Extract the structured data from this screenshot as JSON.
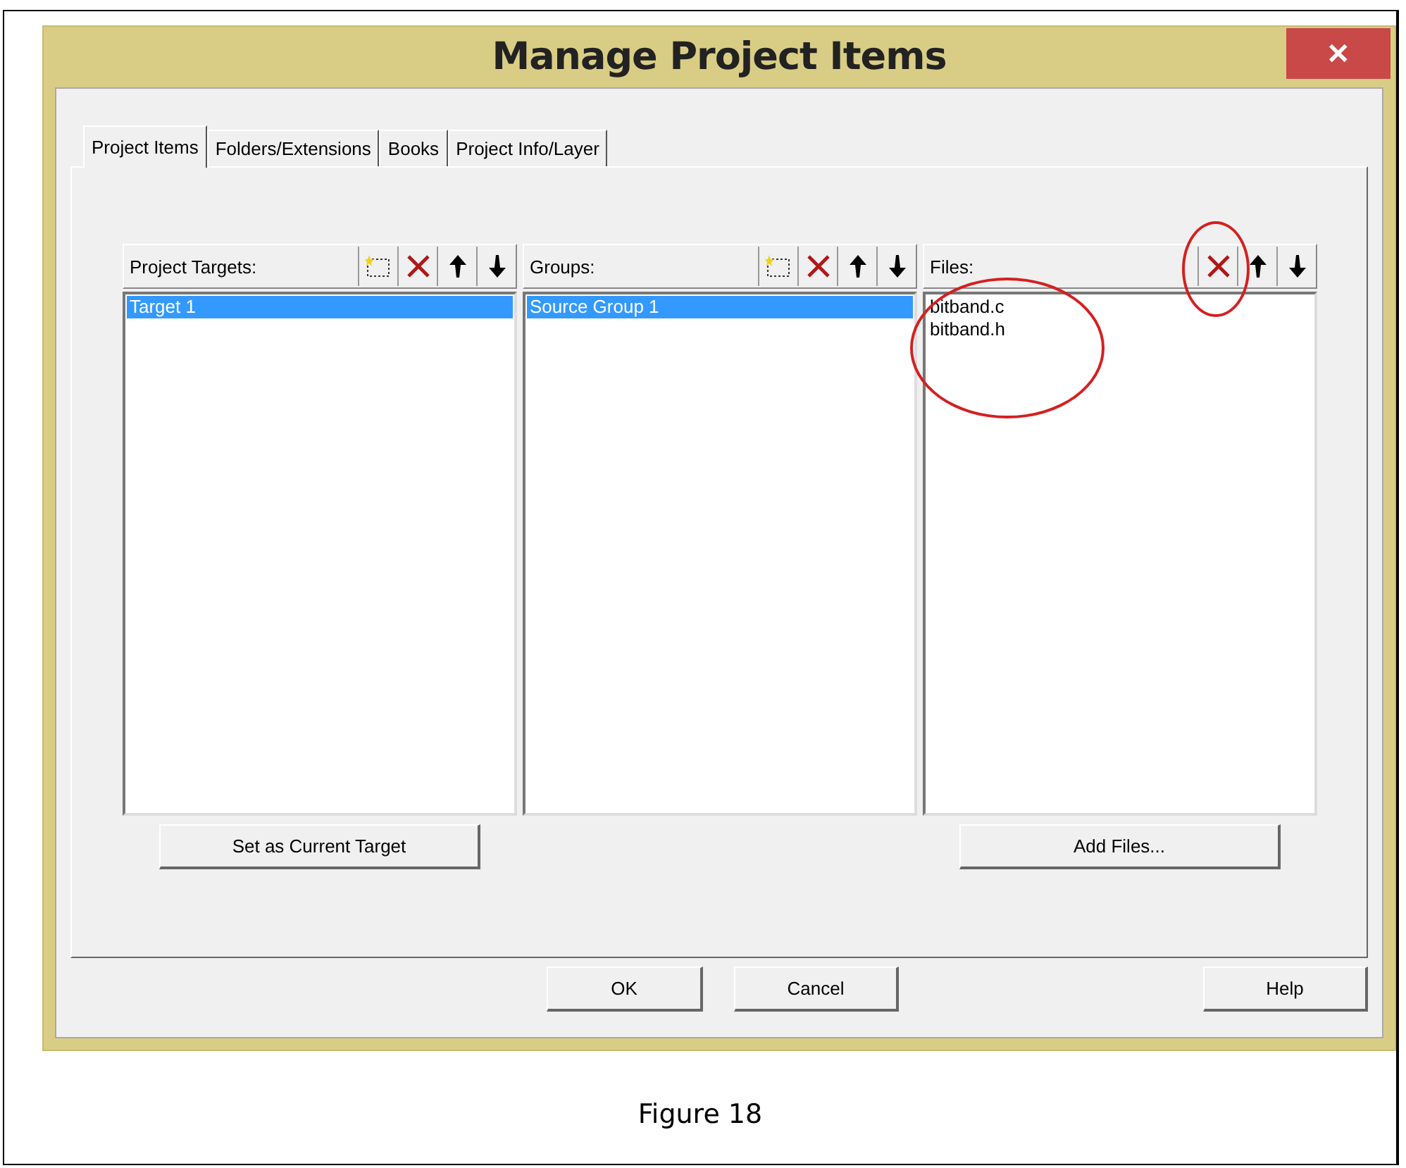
{
  "window": {
    "title": "Manage Project Items",
    "close": "✕"
  },
  "tabs": [
    {
      "label": "Project Items",
      "selected": true
    },
    {
      "label": "Folders/Extensions",
      "selected": false
    },
    {
      "label": "Books",
      "selected": false
    },
    {
      "label": "Project Info/Layer",
      "selected": false
    }
  ],
  "panels": [
    {
      "label": "Project Targets:",
      "tools": [
        {
          "kind": "new",
          "circled": false
        },
        {
          "kind": "delete",
          "circled": false
        },
        {
          "kind": "up",
          "circled": false
        },
        {
          "kind": "down",
          "circled": false
        }
      ],
      "items": [
        {
          "label": "Target 1",
          "selected": true
        }
      ],
      "items_circled": false,
      "button": "Set as Current Target"
    },
    {
      "label": "Groups:",
      "tools": [
        {
          "kind": "new",
          "circled": false
        },
        {
          "kind": "delete",
          "circled": false
        },
        {
          "kind": "up",
          "circled": false
        },
        {
          "kind": "down",
          "circled": false
        }
      ],
      "items": [
        {
          "label": "Source Group 1",
          "selected": true
        }
      ],
      "items_circled": false
    },
    {
      "label": "Files:",
      "tools": [
        {
          "kind": "delete",
          "circled": true
        },
        {
          "kind": "up",
          "circled": false
        },
        {
          "kind": "down",
          "circled": false
        }
      ],
      "items": [
        {
          "label": "bitband.c",
          "selected": false
        },
        {
          "label": "bitband.h",
          "selected": false
        }
      ],
      "items_circled": true,
      "button": "Add Files..."
    }
  ],
  "buttons": [
    "OK",
    "Cancel",
    "Help"
  ],
  "caption": "Figure 18"
}
